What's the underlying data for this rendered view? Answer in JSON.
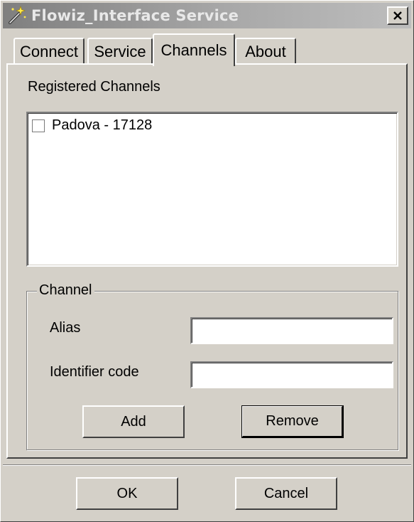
{
  "window": {
    "title": "Flowiz_Interface Service",
    "close_label": "x"
  },
  "tabs": [
    {
      "label": "Connect",
      "active": false
    },
    {
      "label": "Service",
      "active": false
    },
    {
      "label": "Channels",
      "active": true
    },
    {
      "label": "About",
      "active": false
    }
  ],
  "channels_page": {
    "registered_label": "Registered Channels",
    "items": [
      {
        "label": "Padova - 17128",
        "checked": false
      }
    ],
    "group": {
      "title": "Channel",
      "alias_label": "Alias",
      "alias_value": "",
      "identifier_label": "Identifier code",
      "identifier_value": "",
      "add_label": "Add",
      "remove_label": "Remove"
    }
  },
  "footer": {
    "ok_label": "OK",
    "cancel_label": "Cancel"
  },
  "icons": {
    "app": "magic-wand-icon",
    "close": "close-icon"
  },
  "colors": {
    "face": "#d4d0c8",
    "titlebar_inactive_start": "#7f7f7f",
    "titlebar_inactive_end": "#bdbdbd",
    "title_text": "#e8e8e8"
  }
}
